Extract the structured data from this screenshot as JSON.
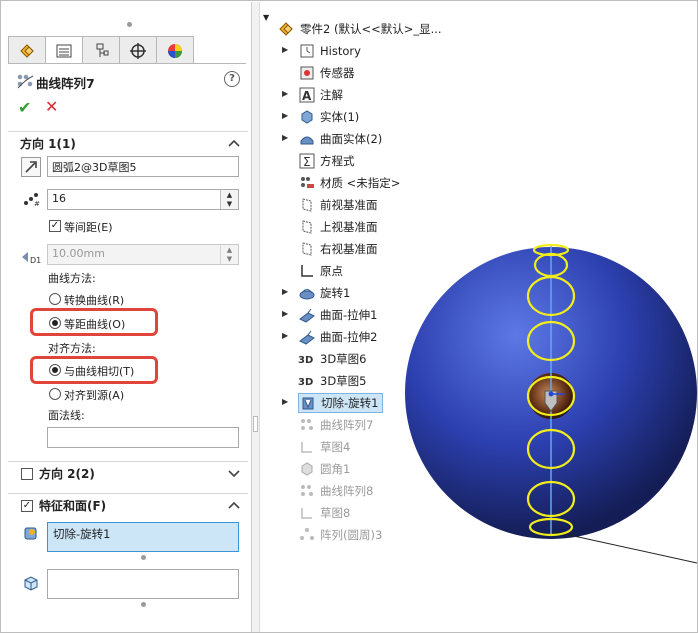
{
  "panel": {
    "title": "曲线阵列7",
    "tabs": [
      "feature-manager",
      "property-manager",
      "configuration-manager",
      "dimxpert-manager",
      "display-manager"
    ],
    "direction1": {
      "header": "方向 1(1)",
      "path_value": "圆弧2@3D草图5",
      "count_value": "16",
      "equal_spacing_label": "等间距(E)",
      "equal_spacing_checked": true,
      "spacing_value": "10.00mm",
      "curve_method_label": "曲线方法:",
      "curve_method_options": [
        "转换曲线(R)",
        "等距曲线(O)"
      ],
      "curve_method_selected": "等距曲线(O)",
      "align_method_label": "对齐方法:",
      "align_method_options": [
        "与曲线相切(T)",
        "对齐到源(A)"
      ],
      "align_method_selected": "与曲线相切(T)",
      "face_normal_label": "面法线:",
      "face_normal_value": ""
    },
    "direction2": {
      "header": "方向 2(2)",
      "checked": false
    },
    "features": {
      "header": "特征和面(F)",
      "checked": true,
      "selected_feature": "切除-旋转1",
      "faces_value": ""
    }
  },
  "tree": {
    "root": "零件2  (默认<<默认>_显...",
    "items": [
      {
        "label": "History",
        "icon": "history-icon",
        "expand": true,
        "dim": false
      },
      {
        "label": "传感器",
        "icon": "sensor-icon",
        "expand": false,
        "dim": false
      },
      {
        "label": "注解",
        "icon": "annotation-icon",
        "expand": true,
        "dim": false
      },
      {
        "label": "实体(1)",
        "icon": "solid-body-icon",
        "expand": true,
        "dim": false
      },
      {
        "label": "曲面实体(2)",
        "icon": "surface-body-icon",
        "expand": true,
        "dim": false
      },
      {
        "label": "方程式",
        "icon": "equation-icon",
        "expand": false,
        "dim": false
      },
      {
        "label": "材质 <未指定>",
        "icon": "material-icon",
        "expand": false,
        "dim": false
      },
      {
        "label": "前视基准面",
        "icon": "plane-icon",
        "expand": false,
        "dim": false
      },
      {
        "label": "上视基准面",
        "icon": "plane-icon",
        "expand": false,
        "dim": false
      },
      {
        "label": "右视基准面",
        "icon": "plane-icon",
        "expand": false,
        "dim": false
      },
      {
        "label": "原点",
        "icon": "origin-icon",
        "expand": false,
        "dim": false
      },
      {
        "label": "旋转1",
        "icon": "revolve-icon",
        "expand": true,
        "dim": false
      },
      {
        "label": "曲面-拉伸1",
        "icon": "surface-extrude-icon",
        "expand": true,
        "dim": false
      },
      {
        "label": "曲面-拉伸2",
        "icon": "surface-extrude-icon",
        "expand": true,
        "dim": false
      },
      {
        "label": "3D草图6",
        "icon": "3d-sketch-icon",
        "expand": false,
        "dim": false
      },
      {
        "label": "3D草图5",
        "icon": "3d-sketch-icon",
        "expand": false,
        "dim": false
      },
      {
        "label": "切除-旋转1",
        "icon": "cut-revolve-icon",
        "expand": true,
        "dim": false,
        "selected": true
      },
      {
        "label": "曲线阵列7",
        "icon": "curve-pattern-icon",
        "expand": false,
        "dim": true
      },
      {
        "label": "草图4",
        "icon": "sketch-icon",
        "expand": false,
        "dim": true
      },
      {
        "label": "圆角1",
        "icon": "fillet-icon",
        "expand": false,
        "dim": true
      },
      {
        "label": "曲线阵列8",
        "icon": "curve-pattern-icon",
        "expand": false,
        "dim": true
      },
      {
        "label": "草图8",
        "icon": "sketch-icon",
        "expand": false,
        "dim": true
      },
      {
        "label": "阵列(圆周)3",
        "icon": "circular-pattern-icon",
        "expand": false,
        "dim": true
      }
    ]
  },
  "colors": {
    "accent_red": "#e0443b",
    "sphere_blue": "#2c3fae",
    "highlight_yellow": "#f2ee1b",
    "selection_blue": "#cde6f7"
  }
}
